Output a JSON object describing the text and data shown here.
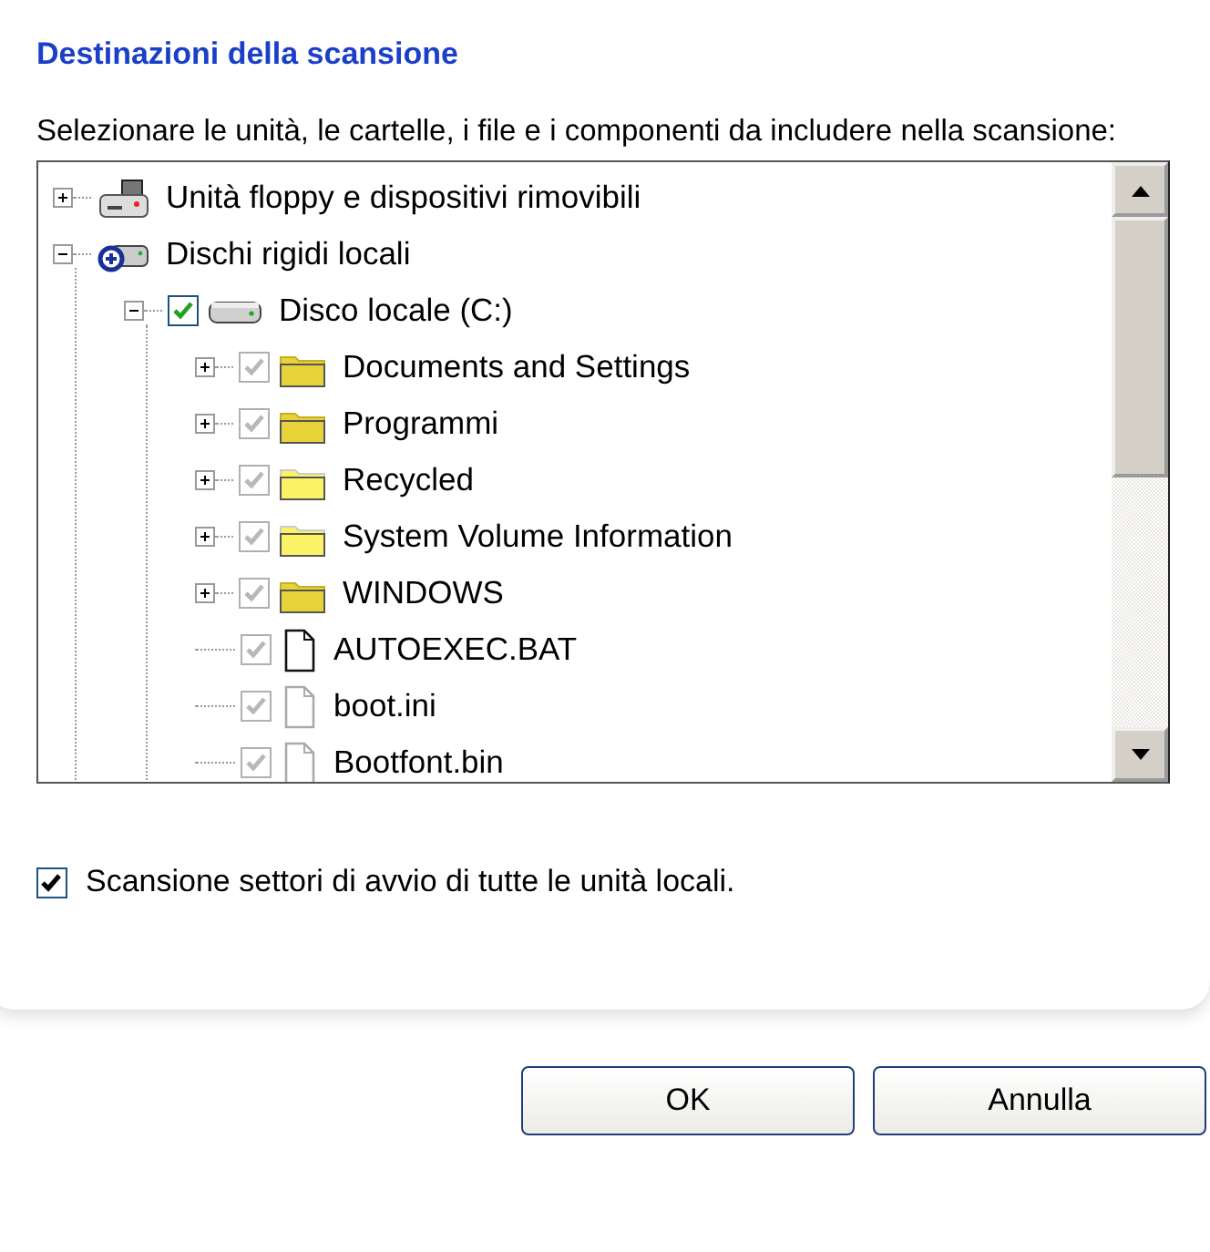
{
  "heading": "Destinazioni della scansione",
  "instruction": "Selezionare le unità, le cartelle, i file e i componenti da includere nella scansione:",
  "tree": [
    {
      "kind": "floppy",
      "label": "Unità floppy e dispositivi rimovibili",
      "expanded": false
    },
    {
      "kind": "drives",
      "label": "Dischi rigidi locali",
      "expanded": true,
      "children": [
        {
          "kind": "disk",
          "label": "Disco locale (C:)",
          "expanded": true,
          "checked": true,
          "disabled": false,
          "children": [
            {
              "kind": "folder",
              "label": "Documents and Settings",
              "expanded": false,
              "checked": true,
              "disabled": true
            },
            {
              "kind": "folder",
              "label": "Programmi",
              "expanded": false,
              "checked": true,
              "disabled": true
            },
            {
              "kind": "folder-light",
              "label": "Recycled",
              "expanded": false,
              "checked": true,
              "disabled": true
            },
            {
              "kind": "folder-light",
              "label": "System Volume Information",
              "expanded": false,
              "checked": true,
              "disabled": true
            },
            {
              "kind": "folder",
              "label": "WINDOWS",
              "expanded": false,
              "checked": true,
              "disabled": true
            },
            {
              "kind": "file",
              "label": "AUTOEXEC.BAT",
              "checked": true,
              "disabled": true
            },
            {
              "kind": "file-light",
              "label": "boot.ini",
              "checked": true,
              "disabled": true
            },
            {
              "kind": "file-light",
              "label": "Bootfont.bin",
              "checked": true,
              "disabled": true
            }
          ]
        }
      ]
    }
  ],
  "boot_sector_option": {
    "label": "Scansione settori di avvio di tutte le unità locali.",
    "checked": true
  },
  "buttons": [
    "OK",
    "Annulla"
  ]
}
